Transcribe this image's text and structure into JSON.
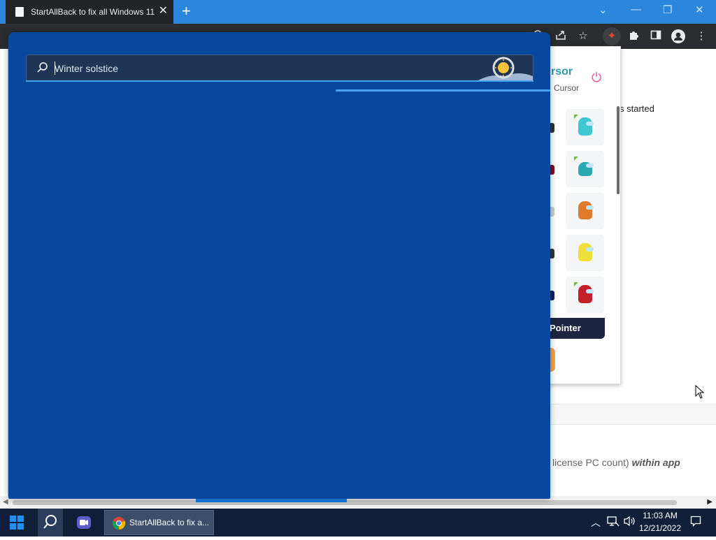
{
  "browser": {
    "tab_title": "StartAllBack to fix all Windows 11",
    "close_tab_glyph": "✕",
    "new_tab_glyph": "+",
    "window_controls": {
      "minimize": "—",
      "restore": "❐",
      "close": "✕",
      "dropdown": "⌄"
    }
  },
  "background_page": {
    "started_text": "s started",
    "license_text": "license PC count)",
    "license_emphasis": "within app"
  },
  "extension_popup": {
    "heading": "rsor",
    "subheading": "Cursor",
    "pointer_button": "Pointer",
    "icons": [
      "power-icon"
    ],
    "cursor_colors": [
      "#3fc7d2",
      "#2aa9b3",
      "#e07a2a",
      "#f0df3a",
      "#c5202a"
    ]
  },
  "search": {
    "placeholder": "Winter solstice",
    "value": ""
  },
  "taskbar": {
    "chrome_label": "StartAllBack to fix a...",
    "time": "11:03 AM",
    "date": "12/21/2022"
  },
  "colors": {
    "search_panel": "#06489b",
    "titlebar": "#2c87dc",
    "taskbar": "#0f2038",
    "accent": "#4aa3ef"
  }
}
